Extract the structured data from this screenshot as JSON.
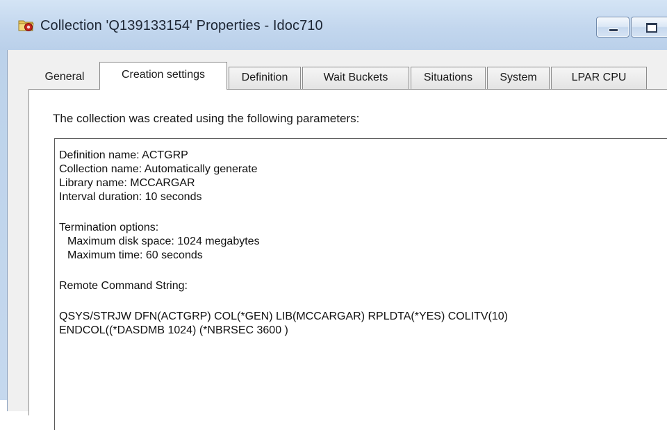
{
  "window": {
    "title": "Collection 'Q139133154' Properties - Idoc710",
    "icon": "collection-folder-icon"
  },
  "tabs": [
    {
      "label": "General",
      "active": false
    },
    {
      "label": "Creation settings",
      "active": true
    },
    {
      "label": "Definition",
      "active": false
    },
    {
      "label": "Wait Buckets",
      "active": false
    },
    {
      "label": "Situations",
      "active": false
    },
    {
      "label": "System",
      "active": false
    },
    {
      "label": "LPAR CPU",
      "active": false
    }
  ],
  "creation_settings": {
    "intro": "The collection was created using the following parameters:",
    "lines": {
      "definition_name": "Definition name:  ACTGRP",
      "collection_name": "Collection name:  Automatically generate",
      "library_name": "Library name:  MCCARGAR",
      "interval_duration": "Interval duration:  10 seconds",
      "termination_heading": "Termination options:",
      "max_disk": "Maximum disk space:  1024 megabytes",
      "max_time": "Maximum time:  60 seconds",
      "remote_heading": "Remote Command String:",
      "command_line1": "QSYS/STRJW DFN(ACTGRP) COL(*GEN) LIB(MCCARGAR) RPLDTA(*YES) COLITV(10)",
      "command_line2": "ENDCOL((*DASDMB 1024) (*NBRSEC 3600 )"
    }
  },
  "colors": {
    "titlebar": "#c3d7ee",
    "dialog_bg": "#f0f0f0",
    "panel_bg": "#ffffff"
  }
}
